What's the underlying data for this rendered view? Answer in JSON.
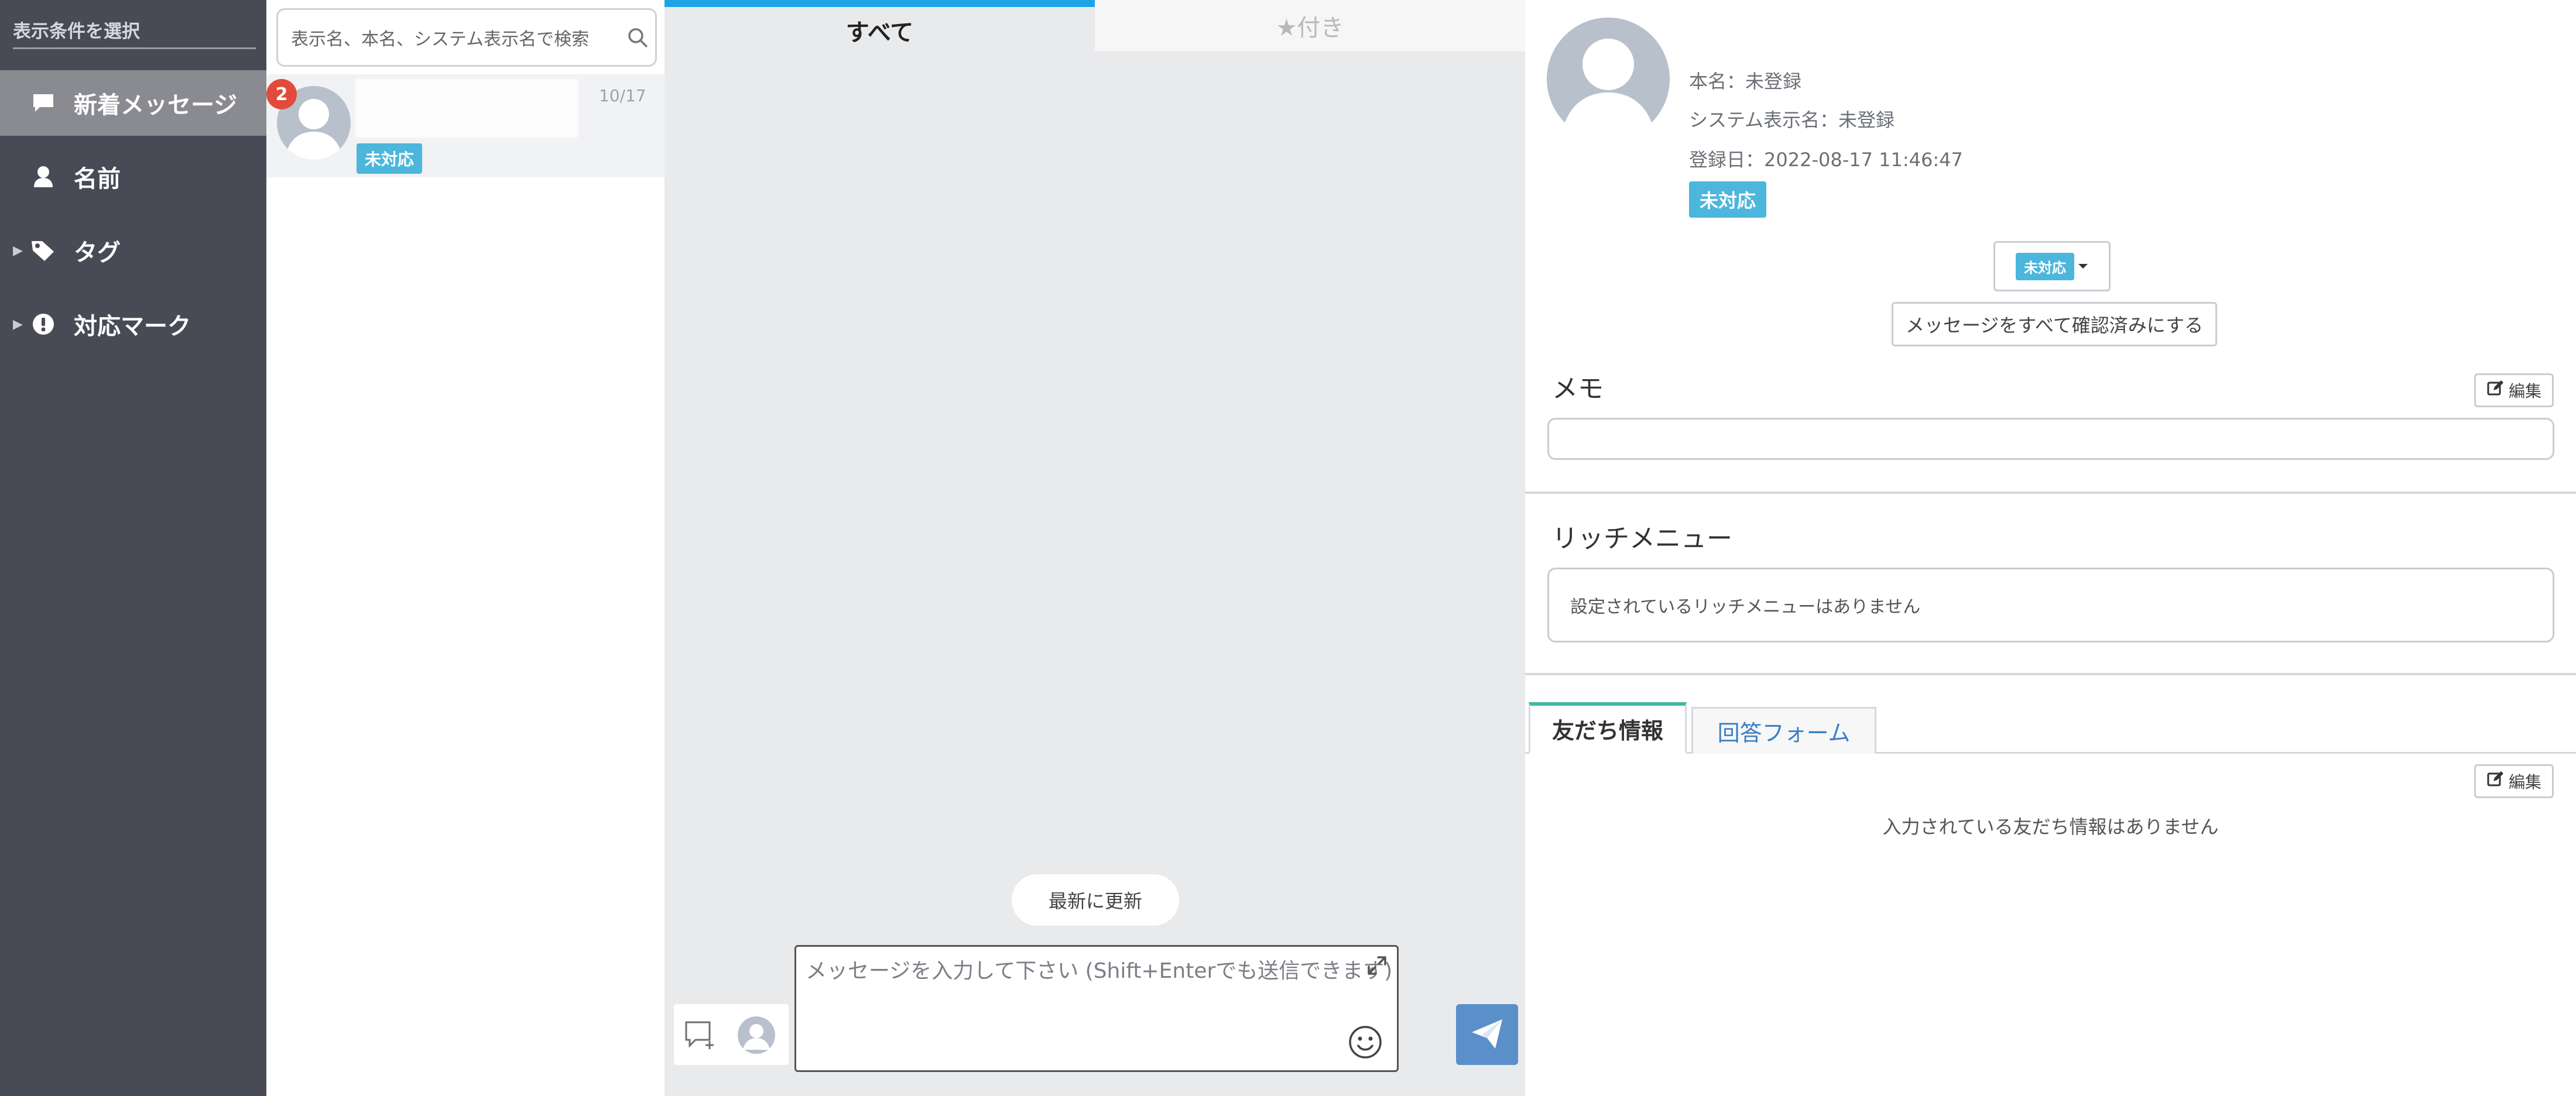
{
  "sidebar": {
    "title": "表示条件を選択",
    "items": [
      {
        "label": "新着メッセージ",
        "icon": "chat-bubble-icon",
        "expandable": false,
        "active": true
      },
      {
        "label": "名前",
        "icon": "person-icon",
        "expandable": false,
        "active": false
      },
      {
        "label": "タグ",
        "icon": "tag-icon",
        "expandable": true,
        "active": false
      },
      {
        "label": "対応マーク",
        "icon": "alert-circle-icon",
        "expandable": true,
        "active": false
      }
    ]
  },
  "list": {
    "search_placeholder": "表示名、本名、システム表示名で検索",
    "conversations": [
      {
        "name": "",
        "unread_count": "2",
        "date": "10/17",
        "status": "未対応"
      }
    ]
  },
  "chat": {
    "tabs": [
      {
        "label": "すべて",
        "active": true
      },
      {
        "label": "★付き",
        "active": false
      }
    ],
    "refresh_label": "最新に更新",
    "composer_placeholder": "メッセージを入力して下さい (Shift+Enterでも送信できます)"
  },
  "profile": {
    "display_name": "",
    "real_name": "本名：未登録",
    "system_name": "システム表示名：未登録",
    "registered": "登録日：2022-08-17 11:46:47",
    "status": "未対応",
    "dropdown_status": "未対応",
    "mark_all_read": "メッセージをすべて確認済みにする",
    "memo_heading": "メモ",
    "edit_label": "編集",
    "rich_menu_heading": "リッチメニュー",
    "rich_menu_empty": "設定されているリッチメニューはありません",
    "tabs": [
      {
        "label": "友だち情報",
        "active": true
      },
      {
        "label": "回答フォーム",
        "active": false
      }
    ],
    "friends_empty": "入力されている友だち情報はありません"
  },
  "colors": {
    "sidebar_bg": "#484a55",
    "accent_blue": "#1fa3e8",
    "status_tag": "#4cb6dc",
    "badge_red": "#e24b3b",
    "send_button": "#5b8fca",
    "tab_accent": "#41b7a1"
  }
}
